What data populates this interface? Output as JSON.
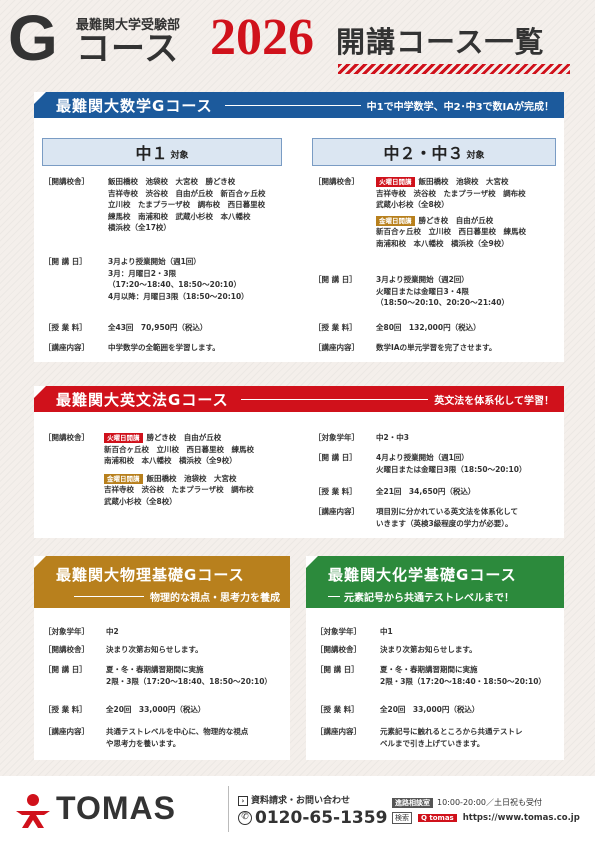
{
  "header": {
    "sub": "最難関大学受験部",
    "g": "G",
    "course_word": "コース",
    "year": "2026",
    "list_title": "開講コース一覧"
  },
  "math": {
    "title": "最難関大数学Gコース",
    "sub": "中1で中学数学、中2･中3で数ⅠAが完成！",
    "left": {
      "grade": "中１",
      "grade_suffix": "対象",
      "schools_label": "［開講校舎］",
      "schools": [
        "飯田橋校　池袋校　大宮校　勝どき校",
        "吉祥寺校　渋谷校　自由が丘校　新百合ヶ丘校",
        "立川校　たまプラーザ校　調布校　西日暮里校",
        "練馬校　南浦和校　武蔵小杉校　本八幡校",
        "横浜校（全17校）"
      ],
      "date_label": "［開 講 日］",
      "date": [
        "3月より授業開始（週1回）",
        "3月：月曜日2・3限",
        "（17:20～18:40、18:50～20:10）",
        "4月以降：月曜日3限（18:50～20:10）"
      ],
      "fee_label": "［授 業 料］",
      "fee": "全43回　70,950円（税込）",
      "content_label": "［講座内容］",
      "content": "中学数学の全範囲を学習します。"
    },
    "right": {
      "grade": "中２・中３",
      "grade_suffix": "対象",
      "schools_label": "［開講校舎］",
      "tag1": "火曜日開講",
      "tue": [
        "飯田橋校　池袋校　大宮校",
        "吉祥寺校　渋谷校　たまプラーザ校　調布校",
        "武蔵小杉校（全8校）"
      ],
      "tag2": "金曜日開講",
      "fri": [
        "勝どき校　自由が丘校",
        "新百合ヶ丘校　立川校　西日暮里校　練馬校",
        "南浦和校　本八幡校　横浜校（全9校）"
      ],
      "date_label": "［開 講 日］",
      "date": [
        "3月より授業開始（週2回）",
        "火曜日または金曜日3・4限",
        "（18:50～20:10、20:20～21:40）"
      ],
      "fee_label": "［授 業 料］",
      "fee": "全80回　132,000円（税込）",
      "content_label": "［講座内容］",
      "content": "数学ⅠAの単元学習を完了させます。"
    }
  },
  "english": {
    "title": "最難関大英文法Gコース",
    "sub": "英文法を体系化して学習！",
    "schools_label": "［開講校舎］",
    "tag1": "火曜日開講",
    "tue": [
      "勝どき校　自由が丘校",
      "新百合ヶ丘校　立川校　西日暮里校　練馬校",
      "南浦和校　本八幡校　横浜校（全9校）"
    ],
    "tag2": "金曜日開講",
    "fri": [
      "飯田橋校　池袋校　大宮校",
      "吉祥寺校　渋谷校　たまプラーザ校　調布校",
      "武蔵小杉校（全8校）"
    ],
    "grade_label": "［対象学年］",
    "grade": "中2・中3",
    "date_label": "［開 講 日］",
    "date": [
      "4月より授業開始（週1回）",
      "火曜日または金曜日3限（18:50～20:10）"
    ],
    "fee_label": "［授 業 料］",
    "fee": "全21回　34,650円（税込）",
    "content_label": "［講座内容］",
    "content": [
      "項目別に分かれている英文法を体系化して",
      "いきます（英検3級程度の学力が必要）。"
    ]
  },
  "physics": {
    "title": "最難関大物理基礎Gコース",
    "sub": "物理的な視点・思考力を養成",
    "grade_label": "［対象学年］",
    "grade": "中2",
    "schools_label": "［開講校舎］",
    "schools": "決まり次第お知らせします。",
    "date_label": "［開 講 日］",
    "date": [
      "夏・冬・春期講習期間に実施",
      "2限・3限（17:20～18:40、18:50～20:10）"
    ],
    "fee_label": "［授 業 料］",
    "fee": "全20回　33,000円（税込）",
    "content_label": "［講座内容］",
    "content": [
      "共通テストレベルを中心に、物理的な視点",
      "や思考力を養います。"
    ]
  },
  "chemistry": {
    "title": "最難関大化学基礎Gコース",
    "sub": "元素記号から共通テストレベルまで！",
    "grade_label": "［対象学年］",
    "grade": "中1",
    "schools_label": "［開講校舎］",
    "schools": "決まり次第お知らせします。",
    "date_label": "［開 講 日］",
    "date": [
      "夏・冬・春期講習期間に実施",
      "2限・3限（17:20～18:40・18:50～20:10）"
    ],
    "fee_label": "［授 業 料］",
    "fee": "全20回　33,000円（税込）",
    "content_label": "［講座内容］",
    "content": [
      "元素記号に触れるところから共通テストレ",
      "ベルまで引き上げていきます。"
    ]
  },
  "footer": {
    "logo": "TOMAS",
    "request": "資料請求・お問い合わせ",
    "phone": "0120-65-1359",
    "hours_tag": "進路相談室",
    "hours": "10:00-20:00／土日祝も受付",
    "search_box": "検索",
    "search_q": "Q tomas",
    "url": "https://www.tomas.co.jp"
  },
  "colors": {
    "red": "#d0111b",
    "blue": "#1c5a9c",
    "gold": "#b8801d",
    "green": "#2c8a3c"
  }
}
